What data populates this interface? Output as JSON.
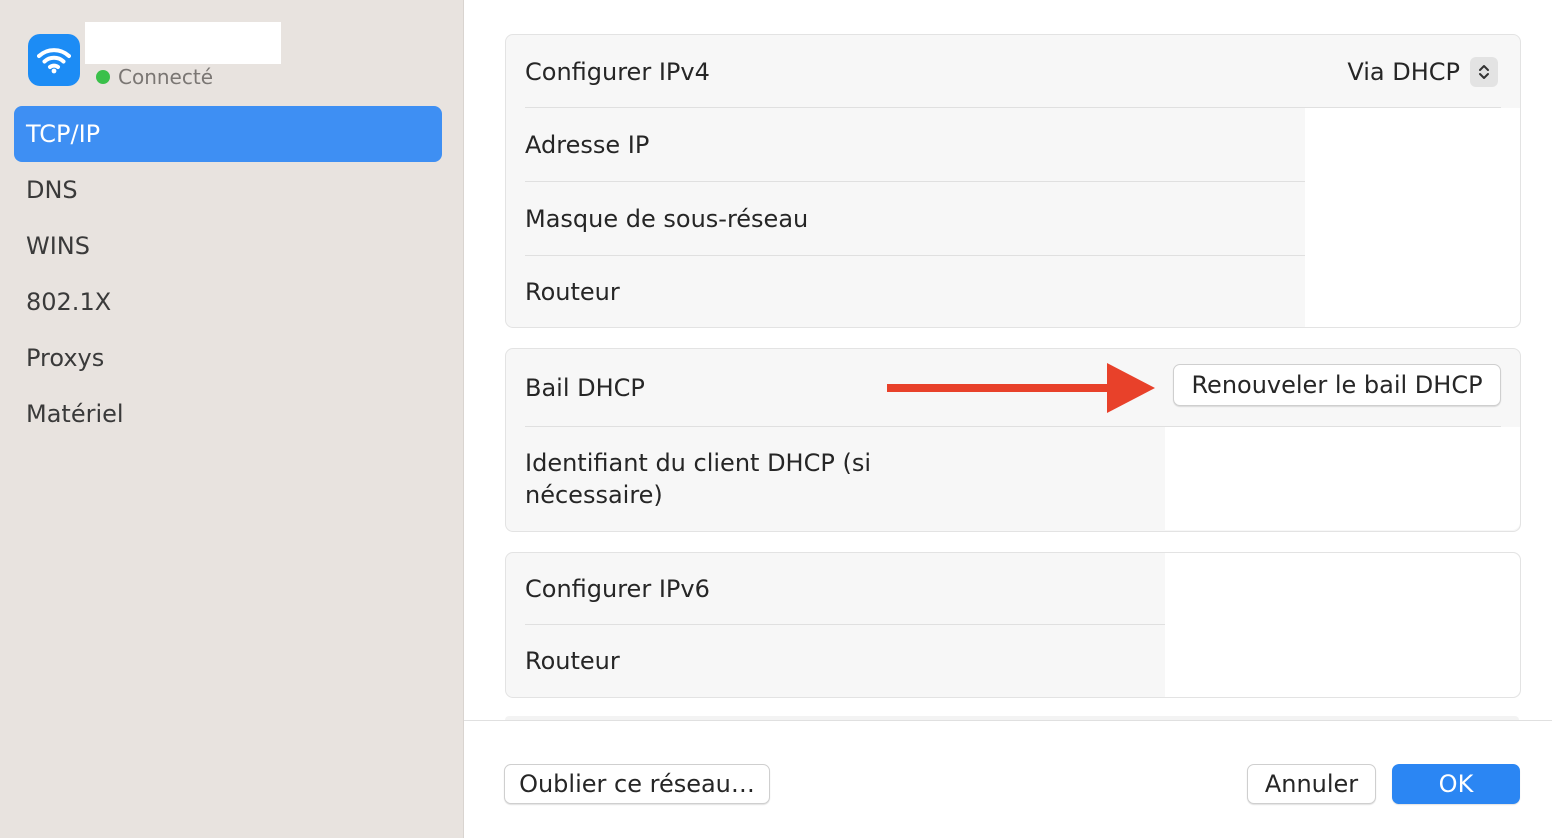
{
  "network": {
    "status": "Connecté",
    "status_color": "#3ac04a",
    "icon": "wifi-icon"
  },
  "sidebar": {
    "items": [
      {
        "label": "TCP/IP",
        "active": true
      },
      {
        "label": "DNS"
      },
      {
        "label": "WINS"
      },
      {
        "label": "802.1X"
      },
      {
        "label": "Proxys"
      },
      {
        "label": "Matériel"
      }
    ]
  },
  "ipv4": {
    "configure_label": "Configurer IPv4",
    "configure_value": "Via DHCP",
    "ip_label": "Adresse IP",
    "subnet_label": "Masque de sous-réseau",
    "router_label": "Routeur"
  },
  "dhcp": {
    "lease_label": "Bail DHCP",
    "renew_button": "Renouveler le bail DHCP",
    "client_id_label": "Identifiant du client DHCP (si nécessaire)"
  },
  "ipv6": {
    "configure_label": "Configurer IPv6",
    "router_label": "Routeur"
  },
  "footer": {
    "forget_button": "Oublier ce réseau…",
    "cancel_button": "Annuler",
    "ok_button": "OK"
  },
  "colors": {
    "accent": "#2b86f3",
    "annotation_arrow": "#e8412a"
  }
}
